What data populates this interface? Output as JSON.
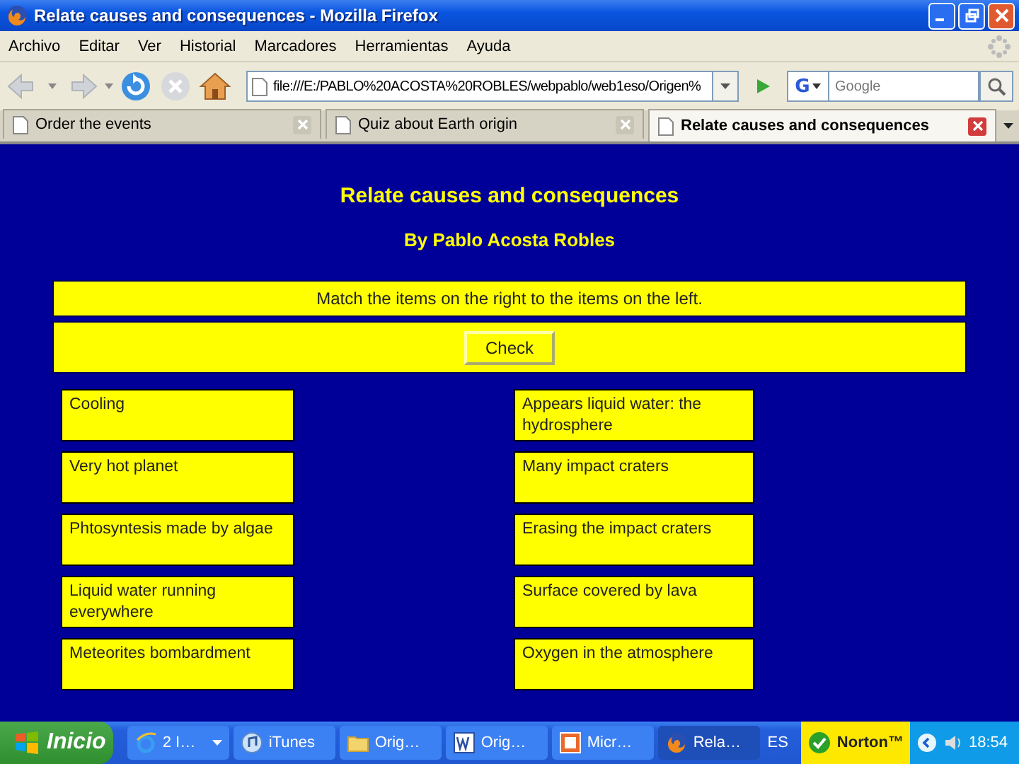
{
  "window": {
    "title": "Relate causes and consequences - Mozilla Firefox"
  },
  "menu": [
    "Archivo",
    "Editar",
    "Ver",
    "Historial",
    "Marcadores",
    "Herramientas",
    "Ayuda"
  ],
  "address": {
    "value": "file:///E:/PABLO%20ACOSTA%20ROBLES/webpablo/web1eso/Origen%"
  },
  "search": {
    "engine": "G",
    "placeholder": "Google"
  },
  "tabs": [
    {
      "label": "Order the events",
      "selected": false
    },
    {
      "label": "Quiz about Earth origin",
      "selected": false
    },
    {
      "label": "Relate causes and consequences",
      "selected": true
    }
  ],
  "page": {
    "title": "Relate causes and consequences",
    "author": "By Pablo Acosta Robles",
    "instruction": "Match the items on the right to the items on the left.",
    "check_button": "Check",
    "left_items": [
      "Cooling",
      "Very hot planet",
      "Phtosyntesis made by algae",
      "Liquid water running everywhere",
      "Meteorites bombardment"
    ],
    "right_items": [
      "Appears liquid water: the hydrosphere",
      "Many impact craters",
      "Erasing the impact craters",
      "Surface covered by lava",
      "Oxygen in the atmosphere"
    ]
  },
  "taskbar": {
    "start": "Inicio",
    "items": [
      {
        "label": "2 I…",
        "kind": "ie",
        "selected": false
      },
      {
        "label": "iTunes",
        "kind": "itunes",
        "selected": false
      },
      {
        "label": "Orig…",
        "kind": "folder",
        "selected": false
      },
      {
        "label": "Orig…",
        "kind": "word",
        "selected": false
      },
      {
        "label": "Micr…",
        "kind": "powerpoint",
        "selected": false
      },
      {
        "label": "Rela…",
        "kind": "firefox",
        "selected": true
      }
    ],
    "language": "ES",
    "norton": "Norton™",
    "clock": "18:54"
  }
}
